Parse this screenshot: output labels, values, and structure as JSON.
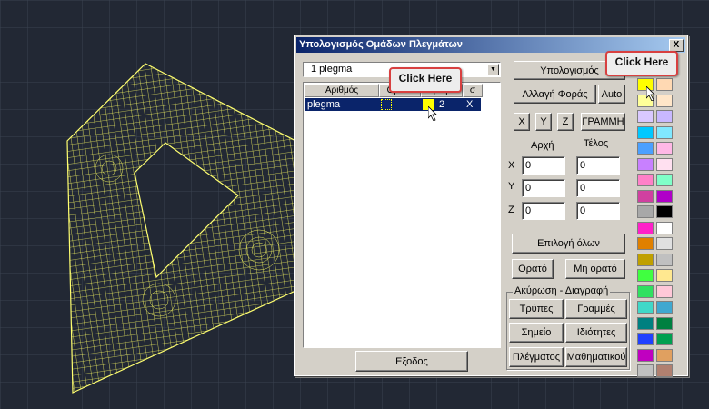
{
  "dialog": {
    "title": "Υπολογισμός Ομάδων Πλεγμάτων",
    "close_label": "X"
  },
  "combo": {
    "value": "1 plegma"
  },
  "list": {
    "headers": [
      "Αριθμός",
      "Ορατό",
      "Χρώμα",
      "σ"
    ],
    "rows": [
      {
        "name": "plegma",
        "color": "#ffff00",
        "count": "2",
        "mark": "X"
      }
    ]
  },
  "buttons": {
    "calculate": "Υπολογισμός",
    "change_direction": "Αλλαγή Φοράς",
    "auto": "Auto",
    "x": "X",
    "y": "Y",
    "z": "Z",
    "line": "ΓΡΑΜΜΗ",
    "select_all": "Επιλογή όλων",
    "visible": "Ορατό",
    "not_visible": "Μη ορατό",
    "holes": "Τρύπες",
    "lines": "Γραμμές",
    "point": "Σημείο",
    "properties": "Ιδιότητες",
    "mesh": "Πλέγματος",
    "math": "Μαθηματικού",
    "exit": "Εξοδος"
  },
  "coords": {
    "start_label": "Αρχή",
    "end_label": "Τέλος",
    "axes": [
      "X",
      "Y",
      "Z"
    ],
    "start": [
      "0",
      "0",
      "0"
    ],
    "end": [
      "0",
      "0",
      "0"
    ]
  },
  "group_label": "Ακύρωση - Διαγραφή",
  "palette": [
    [
      "#ffff00",
      "#ffd9b3"
    ],
    [
      "#ffff99",
      "#ffe6c8"
    ],
    [
      "#d9c8ff",
      "#c8b8ff"
    ],
    [
      "#00c8ff",
      "#80e8ff"
    ],
    [
      "#4aa0ff",
      "#ffb8e6"
    ],
    [
      "#c880ff",
      "#ffe0f0"
    ],
    [
      "#ff80c8",
      "#80ffc8"
    ],
    [
      "#d040a0",
      "#b000c8"
    ],
    [
      "#a8a8a8",
      "#000000"
    ],
    [
      "#ff20c8",
      "#ffffff"
    ],
    [
      "#e08000",
      "#e0e0e0"
    ],
    [
      "#c0a000",
      "#c0c0c0"
    ],
    [
      "#40ff40",
      "#ffe890"
    ],
    [
      "#30e060",
      "#ffc8d8"
    ],
    [
      "#40d8c8",
      "#40a8d0"
    ],
    [
      "#008080",
      "#008040"
    ],
    [
      "#2040ff",
      "#00a050"
    ],
    [
      "#c000c0",
      "#e0a060"
    ],
    [
      "#c0c0c0",
      "#b08070"
    ]
  ],
  "callouts": {
    "left": "Click Here",
    "right": "Click Here"
  },
  "mesh_color": "#ffff66"
}
